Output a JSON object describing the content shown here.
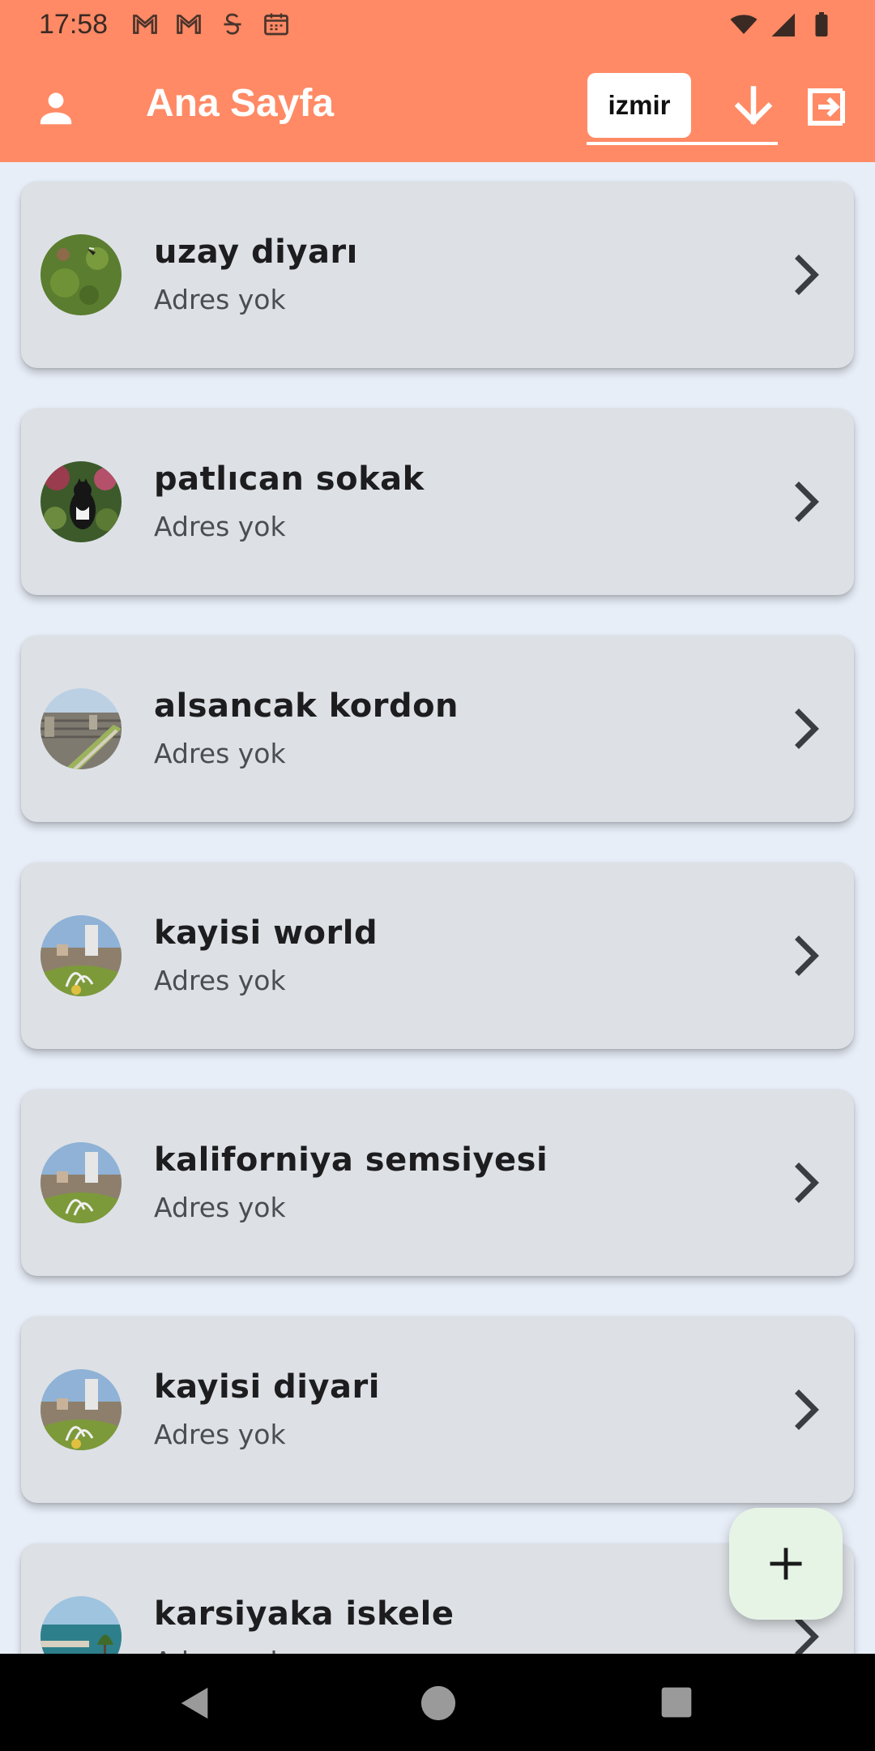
{
  "status_bar": {
    "time": "17:58",
    "notification_icons": [
      "gmail-icon",
      "gmail-icon",
      "s-app-icon",
      "calendar-icon"
    ],
    "system_icons": [
      "wifi-icon",
      "signal-icon",
      "battery-icon"
    ]
  },
  "app_bar": {
    "title": "Ana Sayfa",
    "city": "izmir",
    "color": "#ff8a65"
  },
  "places": [
    {
      "name": "uzay diyarı",
      "address": "Adres yok",
      "thumb": "grass"
    },
    {
      "name": "patlıcan sokak",
      "address": "Adres yok",
      "thumb": "cat"
    },
    {
      "name": "alsancak kordon",
      "address": "Adres yok",
      "thumb": "city"
    },
    {
      "name": "kayisi world",
      "address": "Adres yok",
      "thumb": "fountain"
    },
    {
      "name": "kaliforniya semsiyesi",
      "address": "Adres yok",
      "thumb": "fountain"
    },
    {
      "name": "kayisi diyari",
      "address": "Adres yok",
      "thumb": "fountain"
    },
    {
      "name": "karsiyaka iskele",
      "address": "Adres yok",
      "thumb": "coast"
    }
  ],
  "fab": {
    "icon": "plus-icon"
  },
  "nav_bar": {
    "icons": [
      "back-icon",
      "home-icon",
      "recents-icon"
    ]
  }
}
